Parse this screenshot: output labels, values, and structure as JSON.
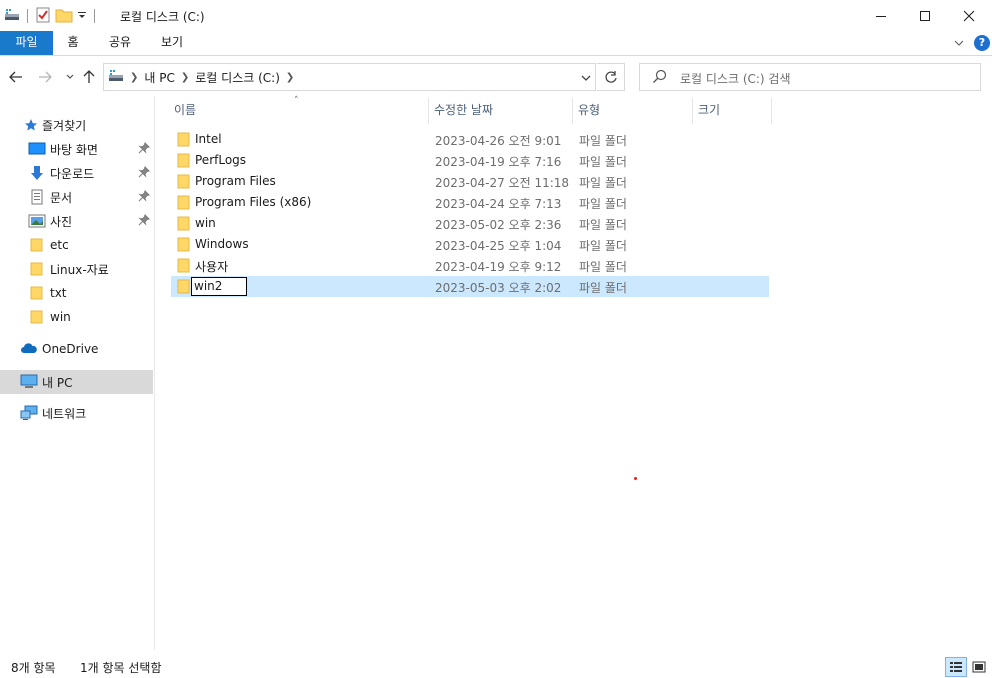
{
  "window": {
    "title": "로컬 디스크 (C:)",
    "accent": "#1979ca"
  },
  "ribbon": {
    "tabs": [
      {
        "label": "파일",
        "active": true
      },
      {
        "label": "홈"
      },
      {
        "label": "공유"
      },
      {
        "label": "보기"
      }
    ],
    "help_label": "?"
  },
  "address": {
    "segments": [
      "내 PC",
      "로컬 디스크 (C:)"
    ],
    "refresh_icon": "refresh-icon"
  },
  "search": {
    "placeholder": "로컬 디스크 (C:) 검색"
  },
  "navpane": {
    "quick_access": "즐겨찾기",
    "items": [
      {
        "label": "바탕 화면",
        "icon": "desktop-icon",
        "pinned": true
      },
      {
        "label": "다운로드",
        "icon": "download-icon",
        "pinned": true
      },
      {
        "label": "문서",
        "icon": "document-icon",
        "pinned": true
      },
      {
        "label": "사진",
        "icon": "pictures-icon",
        "pinned": true
      },
      {
        "label": "etc",
        "icon": "folder-icon"
      },
      {
        "label": "Linux-자료",
        "icon": "folder-icon"
      },
      {
        "label": "txt",
        "icon": "folder-icon"
      },
      {
        "label": "win",
        "icon": "folder-icon"
      }
    ],
    "onedrive": "OneDrive",
    "thispc": "내 PC",
    "network": "네트워크"
  },
  "columns": {
    "name": "이름",
    "date": "수정한 날짜",
    "type": "유형",
    "size": "크기"
  },
  "files": [
    {
      "name": "Intel",
      "date": "2023-04-26 오전 9:01",
      "type": "파일 폴더"
    },
    {
      "name": "PerfLogs",
      "date": "2023-04-19 오후 7:16",
      "type": "파일 폴더"
    },
    {
      "name": "Program Files",
      "date": "2023-04-27 오전 11:18",
      "type": "파일 폴더"
    },
    {
      "name": "Program Files (x86)",
      "date": "2023-04-24 오후 7:13",
      "type": "파일 폴더"
    },
    {
      "name": "win",
      "date": "2023-05-02 오후 2:36",
      "type": "파일 폴더"
    },
    {
      "name": "Windows",
      "date": "2023-04-25 오후 1:04",
      "type": "파일 폴더"
    },
    {
      "name": "사용자",
      "date": "2023-04-19 오후 9:12",
      "type": "파일 폴더"
    },
    {
      "name": "win2",
      "date": "2023-05-03 오후 2:02",
      "type": "파일 폴더",
      "selected": true,
      "editing": true
    }
  ],
  "status": {
    "count": "8개 항목",
    "selection": "1개 항목 선택함"
  }
}
